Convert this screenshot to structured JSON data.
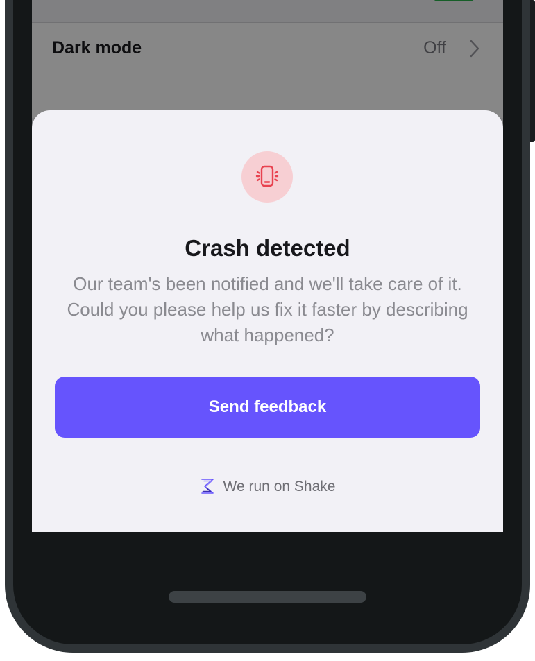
{
  "settings": {
    "dark_mode_label": "Dark mode",
    "dark_mode_value": "Off"
  },
  "crash_sheet": {
    "icon": "phone-shake-icon",
    "title": "Crash detected",
    "message": "Our team's been notified and we'll take care of it. Could you please help us fix it faster by describing what happened?",
    "send_button_label": "Send feedback",
    "branding_text": "We run on Shake",
    "branding_icon": "shake-logo-icon"
  },
  "colors": {
    "accent": "#6654fd",
    "icon_background": "#f7cfd3",
    "icon_stroke": "#e8424f",
    "sheet_background": "#f2f1f6",
    "toggle_on": "#2bb24c"
  }
}
